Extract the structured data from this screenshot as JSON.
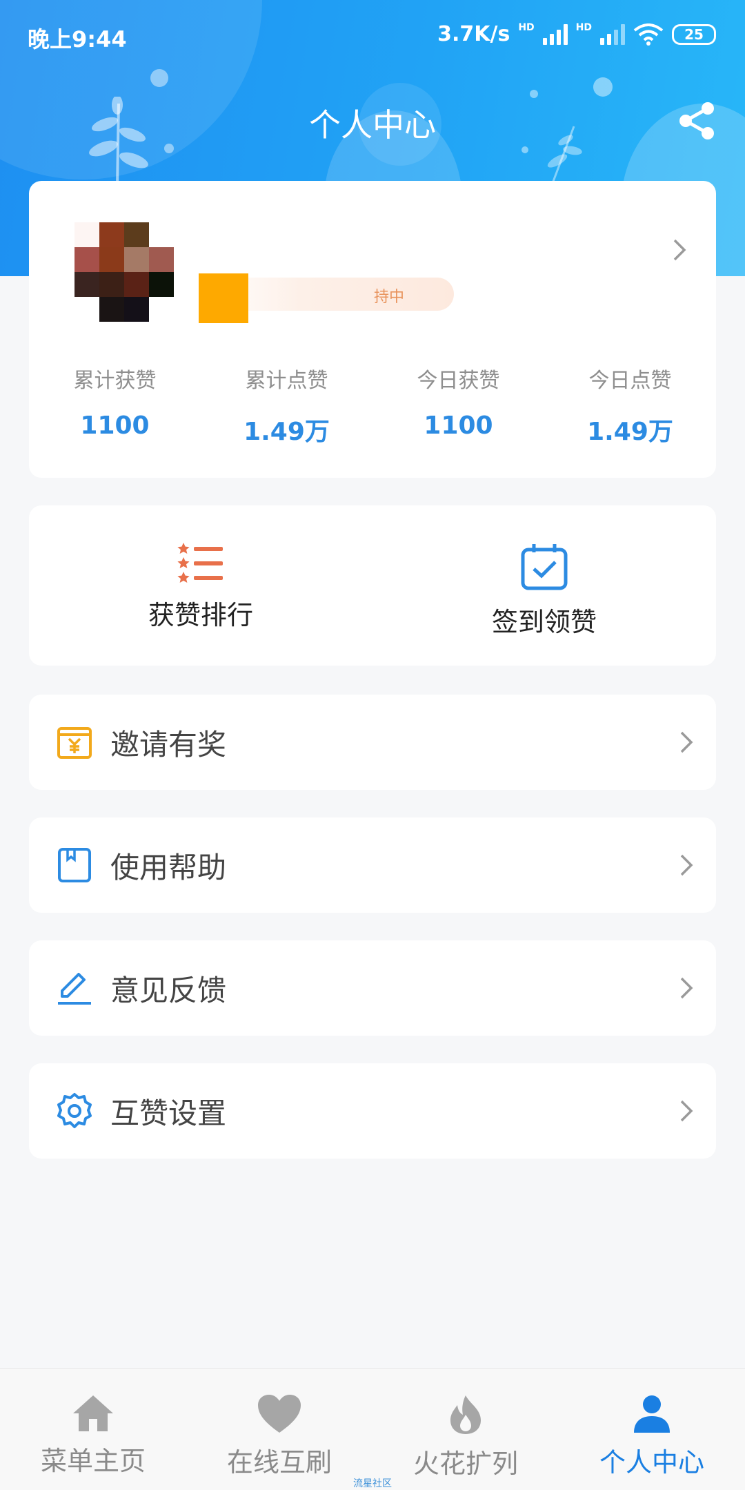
{
  "status_bar": {
    "time": "晚上9:44",
    "speed": "3.7K/s",
    "network_1": "HD",
    "network_2": "HD",
    "battery": "25"
  },
  "header": {
    "title": "个人中心",
    "share_icon": "share-icon"
  },
  "profile": {
    "vip_text": "持中",
    "stats": [
      {
        "label": "累计获赞",
        "value": "1100"
      },
      {
        "label": "累计点赞",
        "value": "1.49万"
      },
      {
        "label": "今日获赞",
        "value": "1100"
      },
      {
        "label": "今日点赞",
        "value": "1.49万"
      }
    ]
  },
  "actions": [
    {
      "label": "获赞排行",
      "icon": "ranking-list-icon"
    },
    {
      "label": "签到领赞",
      "icon": "calendar-check-icon"
    }
  ],
  "menu": [
    {
      "label": "邀请有奖",
      "icon": "invite-reward-icon"
    },
    {
      "label": "使用帮助",
      "icon": "help-book-icon"
    },
    {
      "label": "意见反馈",
      "icon": "feedback-edit-icon"
    },
    {
      "label": "互赞设置",
      "icon": "settings-gear-icon"
    }
  ],
  "nav": [
    {
      "label": "菜单主页",
      "icon": "home-icon",
      "active": false
    },
    {
      "label": "在线互刷",
      "icon": "heart-icon",
      "active": false
    },
    {
      "label": "火花扩列",
      "icon": "flame-icon",
      "active": false
    },
    {
      "label": "个人中心",
      "icon": "user-icon",
      "active": true
    }
  ],
  "watermark": "流星社区",
  "colors": {
    "accent": "#2c8be2",
    "header_start": "#1e8ff1",
    "header_end": "#28b7f8",
    "orange": "#e8704a",
    "invite_gold": "#f2a91b",
    "active_tab": "#1a7fe2"
  }
}
